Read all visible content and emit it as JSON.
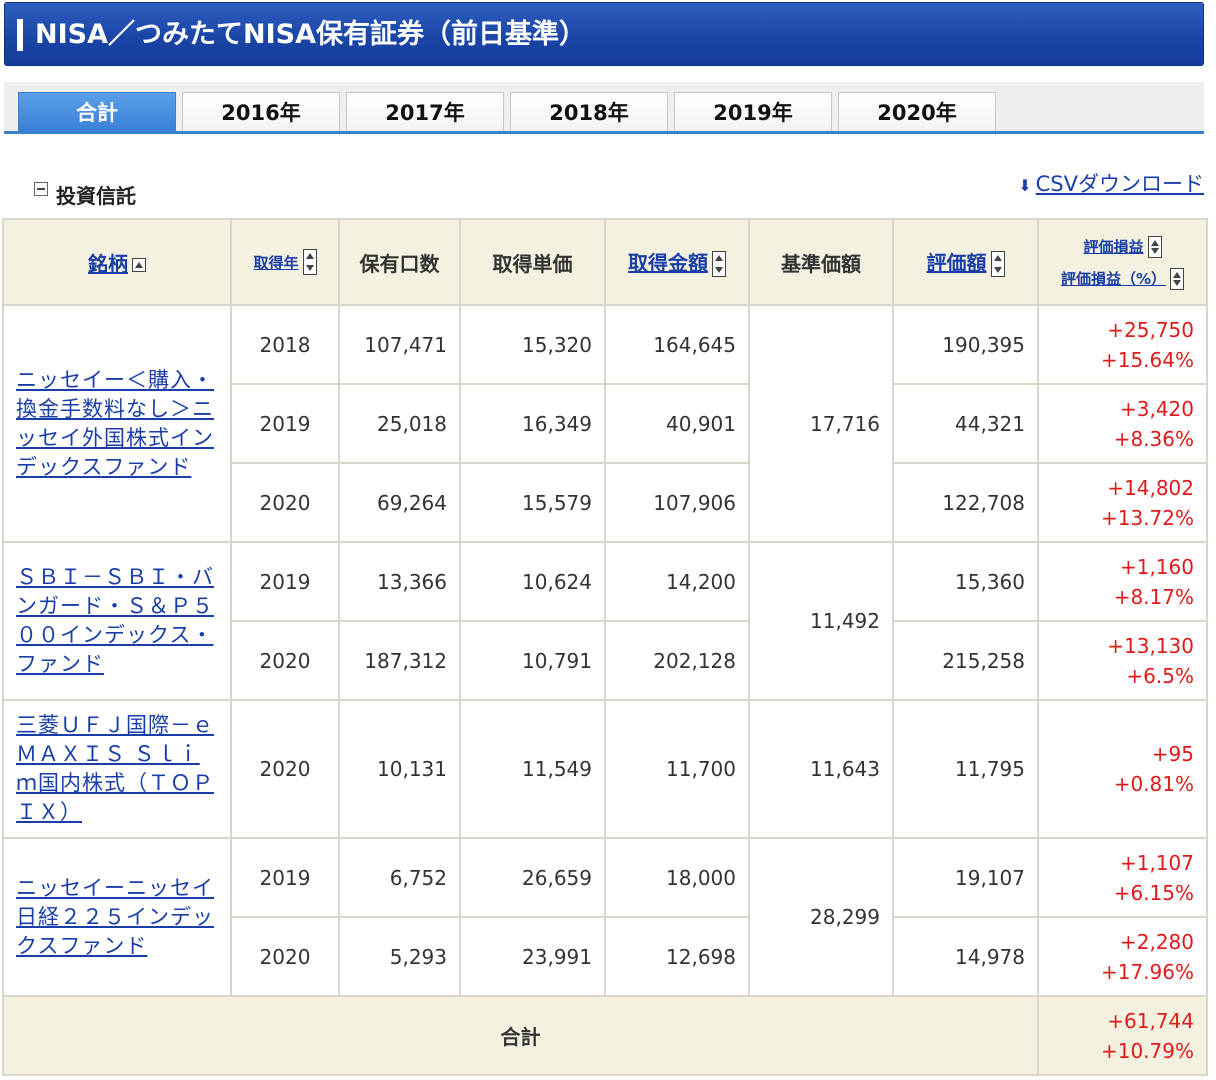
{
  "header": {
    "title": "NISA／つみたてNISA保有証券（前日基準）"
  },
  "tabs": [
    {
      "label": "合計",
      "active": true
    },
    {
      "label": "2016年",
      "active": false
    },
    {
      "label": "2017年",
      "active": false
    },
    {
      "label": "2018年",
      "active": false
    },
    {
      "label": "2019年",
      "active": false
    },
    {
      "label": "2020年",
      "active": false
    }
  ],
  "section": {
    "title": "投資信託",
    "csv_label": "CSVダウンロード"
  },
  "columns": {
    "name": "銘柄",
    "year": "取得年",
    "units": "保有口数",
    "unit_price": "取得単価",
    "cost": "取得金額",
    "nav": "基準価額",
    "value": "評価額",
    "pl": "評価損益",
    "pl_pct": "評価損益（%）"
  },
  "funds": [
    {
      "name": "ニッセイー＜購入・換金手数料なし＞ニッセイ外国株式インデックスファンド",
      "nav": "17,716",
      "rows": [
        {
          "year": "2018",
          "units": "107,471",
          "unit_price": "15,320",
          "cost": "164,645",
          "value": "190,395",
          "pl": "+25,750",
          "pl_pct": "+15.64%"
        },
        {
          "year": "2019",
          "units": "25,018",
          "unit_price": "16,349",
          "cost": "40,901",
          "value": "44,321",
          "pl": "+3,420",
          "pl_pct": "+8.36%"
        },
        {
          "year": "2020",
          "units": "69,264",
          "unit_price": "15,579",
          "cost": "107,906",
          "value": "122,708",
          "pl": "+14,802",
          "pl_pct": "+13.72%"
        }
      ]
    },
    {
      "name": "ＳＢＩ－ＳＢＩ・バンガード・Ｓ＆Ｐ５００インデックス・ファンド",
      "nav": "11,492",
      "rows": [
        {
          "year": "2019",
          "units": "13,366",
          "unit_price": "10,624",
          "cost": "14,200",
          "value": "15,360",
          "pl": "+1,160",
          "pl_pct": "+8.17%"
        },
        {
          "year": "2020",
          "units": "187,312",
          "unit_price": "10,791",
          "cost": "202,128",
          "value": "215,258",
          "pl": "+13,130",
          "pl_pct": "+6.5%"
        }
      ]
    },
    {
      "name": "三菱ＵＦＪ国際－ｅＭＡＸＩＳ Ｓｌｉｍ国内株式（ＴＯＰＩＸ）",
      "nav": "11,643",
      "rows": [
        {
          "year": "2020",
          "units": "10,131",
          "unit_price": "11,549",
          "cost": "11,700",
          "value": "11,795",
          "pl": "+95",
          "pl_pct": "+0.81%"
        }
      ]
    },
    {
      "name": "ニッセイーニッセイ日経２２５インデックスファンド",
      "nav": "28,299",
      "rows": [
        {
          "year": "2019",
          "units": "6,752",
          "unit_price": "26,659",
          "cost": "18,000",
          "value": "19,107",
          "pl": "+1,107",
          "pl_pct": "+6.15%"
        },
        {
          "year": "2020",
          "units": "5,293",
          "unit_price": "23,991",
          "cost": "12,698",
          "value": "14,978",
          "pl": "+2,280",
          "pl_pct": "+17.96%"
        }
      ]
    }
  ],
  "total": {
    "label": "合計",
    "pl": "+61,744",
    "pl_pct": "+10.79%"
  }
}
